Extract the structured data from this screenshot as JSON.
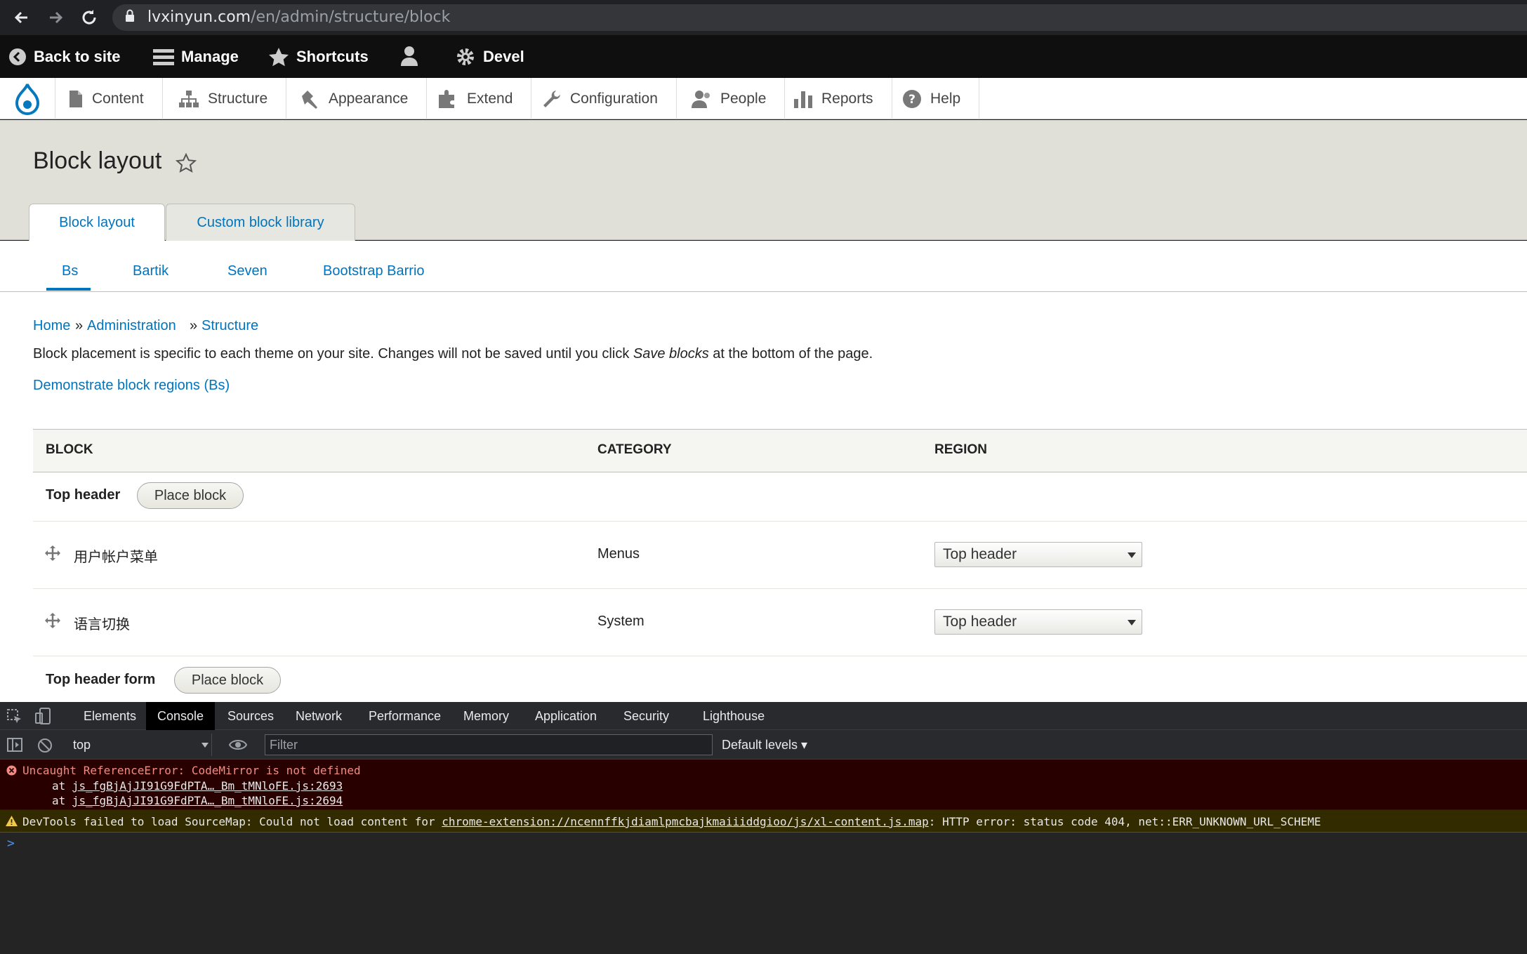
{
  "browser": {
    "url_host": "lvxinyun.com",
    "url_path": "/en/admin/structure/block",
    "back_icon": "arrow-left",
    "forward_icon": "arrow-right",
    "reload_icon": "reload"
  },
  "toolbar": {
    "back_to_site": "Back to site",
    "manage": "Manage",
    "shortcuts": "Shortcuts",
    "devel": "Devel"
  },
  "tray": {
    "items": [
      {
        "label": "Content",
        "icon": "file-icon"
      },
      {
        "label": "Structure",
        "icon": "sitemap-icon"
      },
      {
        "label": "Appearance",
        "icon": "paintbrush-icon"
      },
      {
        "label": "Extend",
        "icon": "puzzle-icon"
      },
      {
        "label": "Configuration",
        "icon": "wrench-icon"
      },
      {
        "label": "People",
        "icon": "people-icon"
      },
      {
        "label": "Reports",
        "icon": "bar-chart-icon"
      },
      {
        "label": "Help",
        "icon": "question-icon"
      }
    ]
  },
  "page": {
    "title": "Block layout",
    "primary_tabs": [
      "Block layout",
      "Custom block library"
    ],
    "secondary_tabs": [
      "Bs",
      "Bartik",
      "Seven",
      "Bootstrap Barrio"
    ],
    "breadcrumb": [
      "Home",
      "Administration",
      "Structure"
    ],
    "breadcrumb_sep": "»",
    "description_pre": "Block placement is specific to each theme on your site. Changes will not be saved until you click ",
    "description_em": "Save blocks",
    "description_post": " at the bottom of the page.",
    "demo_link": "Demonstrate block regions (Bs)"
  },
  "table": {
    "headers": [
      "BLOCK",
      "CATEGORY",
      "REGION"
    ],
    "place_block_label": "Place block",
    "region_top_header": "Top header",
    "region_top_header_form": "Top header form",
    "rows": [
      {
        "block": "用户帐户菜单",
        "category": "Menus",
        "region": "Top header"
      },
      {
        "block": "语言切换",
        "category": "System",
        "region": "Top header"
      }
    ]
  },
  "devtools": {
    "tabs": [
      "Elements",
      "Console",
      "Sources",
      "Network",
      "Performance",
      "Memory",
      "Application",
      "Security",
      "Lighthouse"
    ],
    "active_tab": "Console",
    "context": "top",
    "filter_placeholder": "Filter",
    "levels": "Default levels ▾",
    "error_message": "Uncaught ReferenceError: CodeMirror is not defined",
    "error_at_prefix": "at ",
    "error_frame_1": "js_fgBjAjJI91G9FdPTA…_Bm_tMNloFE.js:2693",
    "error_frame_2": "js_fgBjAjJI91G9FdPTA…_Bm_tMNloFE.js:2694",
    "warning_pre": "DevTools failed to load SourceMap: Could not load content for ",
    "warning_link": "chrome-extension://ncennffkjdiamlpmcbajkmaiiiddgioo/js/xl-content.js.map",
    "warning_post": ": HTTP error: status code 404, net::ERR_UNKNOWN_URL_SCHEME",
    "prompt": ">"
  }
}
